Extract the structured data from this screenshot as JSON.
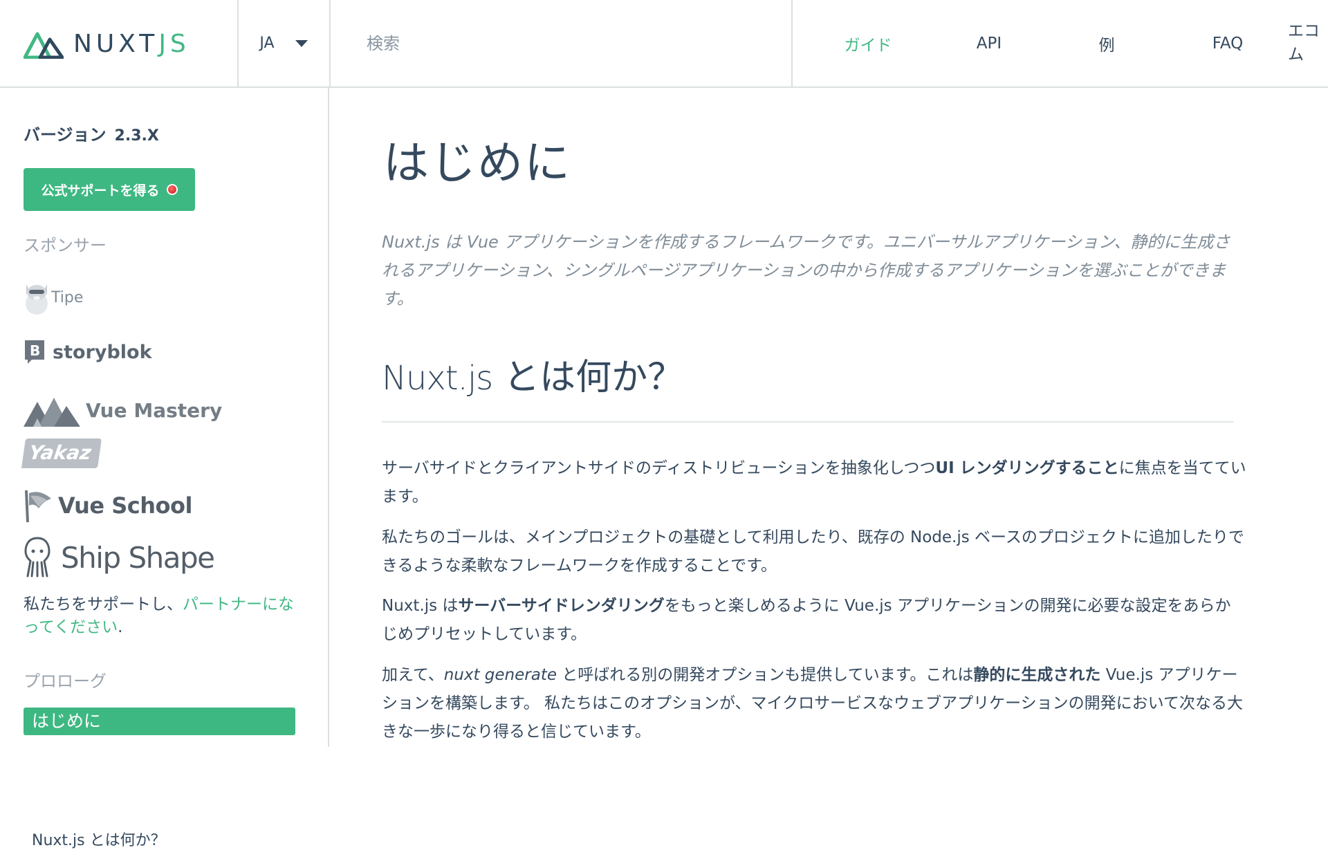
{
  "header": {
    "logo_text_a": "NUXT",
    "logo_text_b": "JS",
    "lang": "JA",
    "search_placeholder": "検索",
    "nav": {
      "guide": "ガイド",
      "api": "API",
      "examples": "例",
      "faq": "FAQ",
      "ecosystem": "エコム"
    }
  },
  "sidebar": {
    "version_label": "バージョン",
    "version_number": "2.3.X",
    "support_button": "公式サポートを得る",
    "sponsors_title": "スポンサー",
    "sponsors": {
      "tipe": "Tipe",
      "storyblok": "storyblok",
      "vue_mastery": "Vue Mastery",
      "yakaz": "Yakaz",
      "vue_school": "Vue School",
      "ship_shape": "Ship Shape"
    },
    "partner_text": "私たちをサポートし、",
    "partner_link": "パートナーになってください",
    "partner_end": ".",
    "prologue_title": "プロローグ",
    "menu_active": "はじめに",
    "menu_next": "Nuxt.js とは何か？"
  },
  "main": {
    "h1": "はじめに",
    "lead": "Nuxt.js は Vue アプリケーションを作成するフレームワークです。ユニバーサルアプリケーション、静的に生成されるアプリケーション、シングルページアプリケーションの中から作成するアプリケーションを選ぶことができます。",
    "h2_latin": "Nuxt.js",
    "h2_jp": "とは何か？",
    "p1": {
      "a": "サーバサイドとクライアントサイドのディストリビューションを抽象化しつつ",
      "b": "UI レンダリングすること",
      "c": "に焦点を当てています。"
    },
    "p2": "私たちのゴールは、メインプロジェクトの基礎として利用したり、既存の Node.js ベースのプロジェクトに追加したりできるような柔軟なフレームワークを作成することです。",
    "p3": {
      "a": "Nuxt.js は",
      "b": "サーバーサイドレンダリング",
      "c": "をもっと楽しめるように Vue.js アプリケーションの開発に必要な設定をあらかじめプリセットしています。"
    },
    "p4": {
      "a": "加えて、",
      "b": "nuxt generate",
      "c": " と呼ばれる別の開発オプションも提供しています。これは",
      "d": "静的に生成された",
      "e": " Vue.js アプリケーションを構築します。 私たちはこのオプションが、マイクロサービスなウェブアプリケーションの開発において次なる大きな一歩になり得ると信じています。"
    }
  },
  "colors": {
    "brand_green": "#41b883",
    "text_dark": "#35495e",
    "muted": "#7f8c97"
  }
}
